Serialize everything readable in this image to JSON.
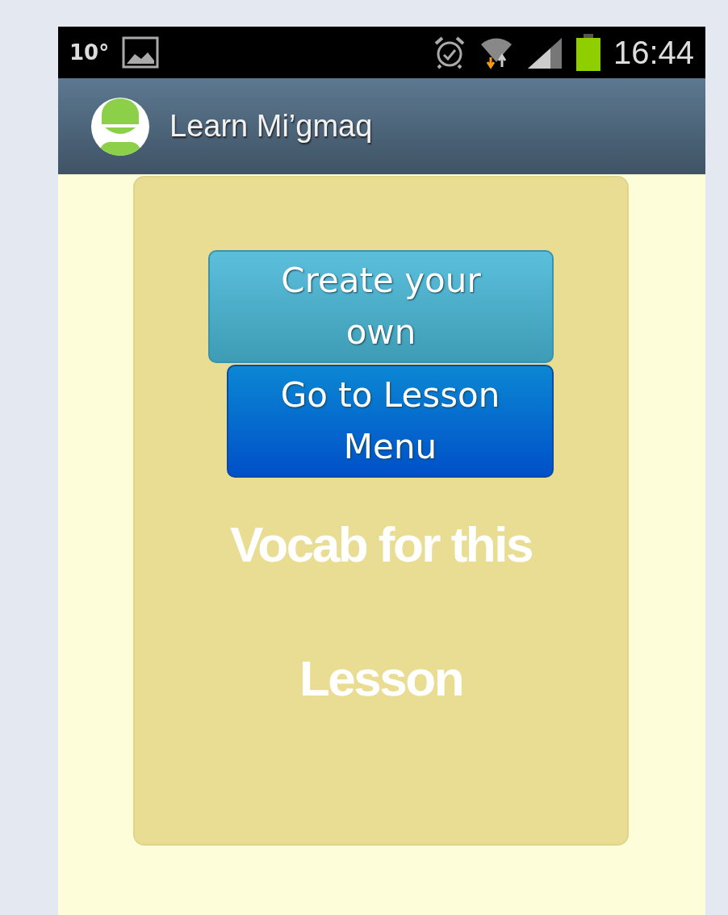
{
  "status_bar": {
    "temperature": "10°",
    "time": "16:44"
  },
  "app_bar": {
    "title": "Learn Mi’gmaq"
  },
  "buttons": [
    {
      "label": "Create your own",
      "kind": "light"
    },
    {
      "label": "Go to Lesson Menu",
      "kind": "dark"
    }
  ],
  "heading": "Vocab for this Lesson"
}
